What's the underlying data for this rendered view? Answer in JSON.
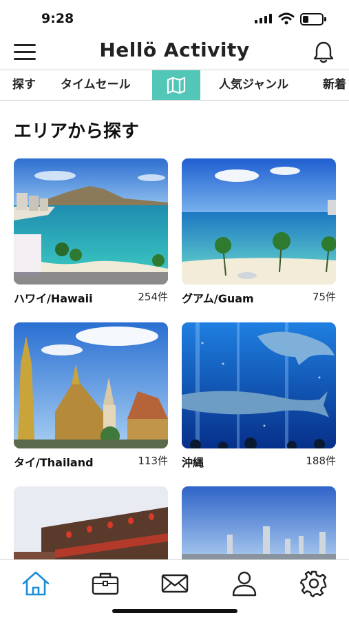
{
  "status": {
    "time": "9:28"
  },
  "header": {
    "logo_text": "Hellö Activity"
  },
  "tabs": [
    {
      "label": "探す"
    },
    {
      "label": "タイムセール"
    },
    {
      "label": "人気ジャンル"
    },
    {
      "label": "新着"
    }
  ],
  "section": {
    "title": "エリアから探す"
  },
  "areas": [
    {
      "name": "ハワイ/Hawaii",
      "count": "254件"
    },
    {
      "name": "グアム/Guam",
      "count": "75件"
    },
    {
      "name": "タイ/Thailand",
      "count": "113件"
    },
    {
      "name": "沖縄",
      "count": "188件"
    }
  ],
  "colors": {
    "accent": "#52c7b7",
    "nav_active": "#1a8cd8"
  },
  "nav_icons": [
    "home-icon",
    "briefcase-icon",
    "mail-icon",
    "user-icon",
    "gear-icon"
  ]
}
